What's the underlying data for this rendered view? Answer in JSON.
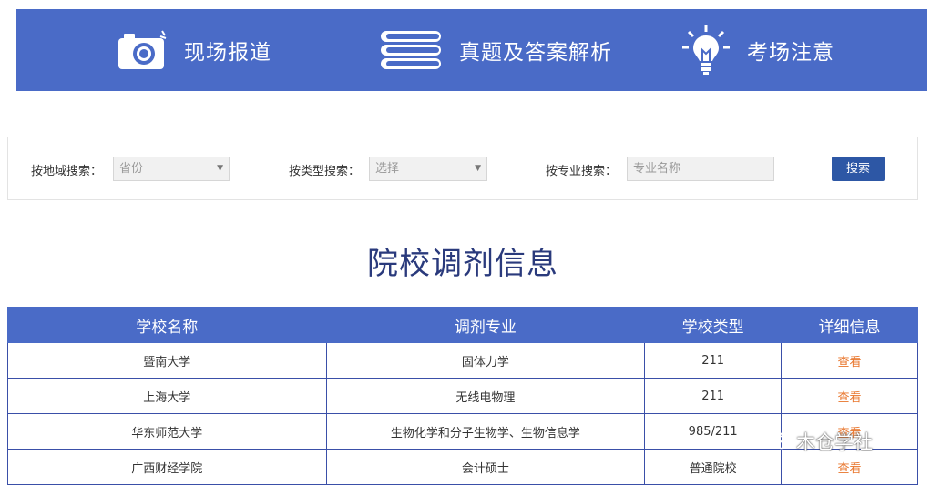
{
  "nav": {
    "items": [
      {
        "label": "现场报道",
        "icon": "camera-icon"
      },
      {
        "label": "真题及答案解析",
        "icon": "books-icon"
      },
      {
        "label": "考场注意",
        "icon": "lightbulb-icon"
      }
    ]
  },
  "search": {
    "region_label": "按地域搜索：",
    "region_placeholder": "省份",
    "type_label": "按类型搜索：",
    "type_placeholder": "选择",
    "major_label": "按专业搜索：",
    "major_placeholder": "专业名称",
    "button_label": "搜索"
  },
  "page_title": "院校调剂信息",
  "table": {
    "headers": [
      "学校名称",
      "调剂专业",
      "学校类型",
      "详细信息"
    ],
    "rows": [
      [
        "暨南大学",
        "固体力学",
        "211",
        "查看"
      ],
      [
        "上海大学",
        "无线电物理",
        "211",
        "查看"
      ],
      [
        "华东师范大学",
        "生物化学和分子生物学、生物信息学",
        "985/211",
        "查看"
      ],
      [
        "广西财经学院",
        "会计硕士",
        "普通院校",
        "查看"
      ]
    ]
  },
  "watermark": "木仓学社",
  "colors": {
    "banner": "#4a6bc7",
    "button": "#2d57a5",
    "title": "#2a3a7c",
    "link": "#e8742a"
  }
}
